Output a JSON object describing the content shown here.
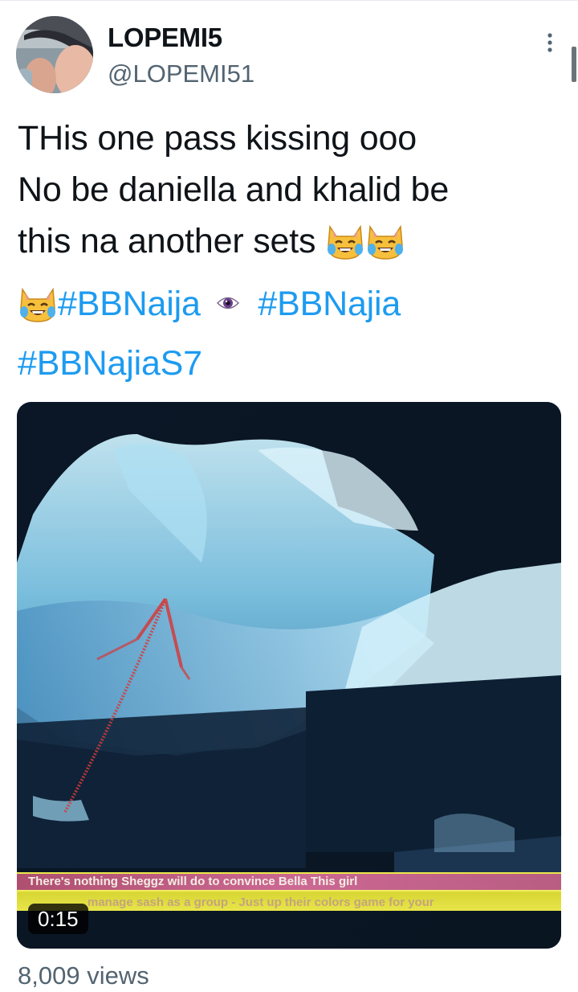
{
  "user": {
    "display_name": "LOPEMI5",
    "handle": "@LOPEMI51"
  },
  "tweet": {
    "line1": "THis one pass kissing ooo",
    "line2": "No be daniella and khalid be",
    "line3": "this na another sets",
    "line3_emojis": [
      "cat-with-tears-of-joy",
      "cat-with-tears-of-joy"
    ],
    "line4_emoji": "cat-with-tears-of-joy",
    "hashtag1": "#BBNaija",
    "eye_emoji": "eye",
    "hashtag2": "#BBNajia",
    "hashtag3": "#BBNajiaS7"
  },
  "media": {
    "duration": "0:15",
    "ticker_line1": "There's nothing Sheggz will do to convince Bella This girl",
    "ticker_line2": "manage sash as a group  - Just up their colors game for your"
  },
  "stats": {
    "views": "8,009 views"
  },
  "colors": {
    "hashtag": "#1d9bf0",
    "secondary_text": "#536471",
    "ticker_yellow": "#e9e84a"
  }
}
